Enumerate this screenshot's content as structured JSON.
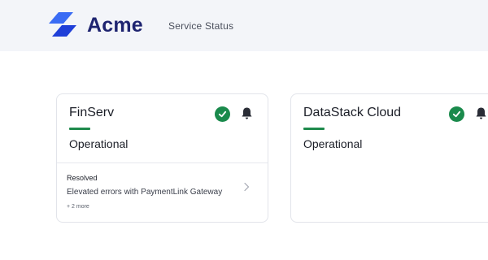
{
  "header": {
    "brand": "Acme",
    "nav_link": "Service Status"
  },
  "colors": {
    "accent_green": "#1a8a4c",
    "brand_navy": "#1e2470",
    "brand_blue": "#2f5cf0"
  },
  "cards": [
    {
      "name": "FinServ",
      "status": "Operational",
      "status_icon": "check-circle-icon",
      "subscribe_icon": "bell-icon",
      "incident": {
        "title": "Resolved",
        "description": "Elevated errors with PaymentLink Gateway",
        "more": "+ 2 more"
      }
    },
    {
      "name": "DataStack Cloud",
      "status": "Operational",
      "status_icon": "check-circle-icon",
      "subscribe_icon": "bell-icon"
    }
  ]
}
